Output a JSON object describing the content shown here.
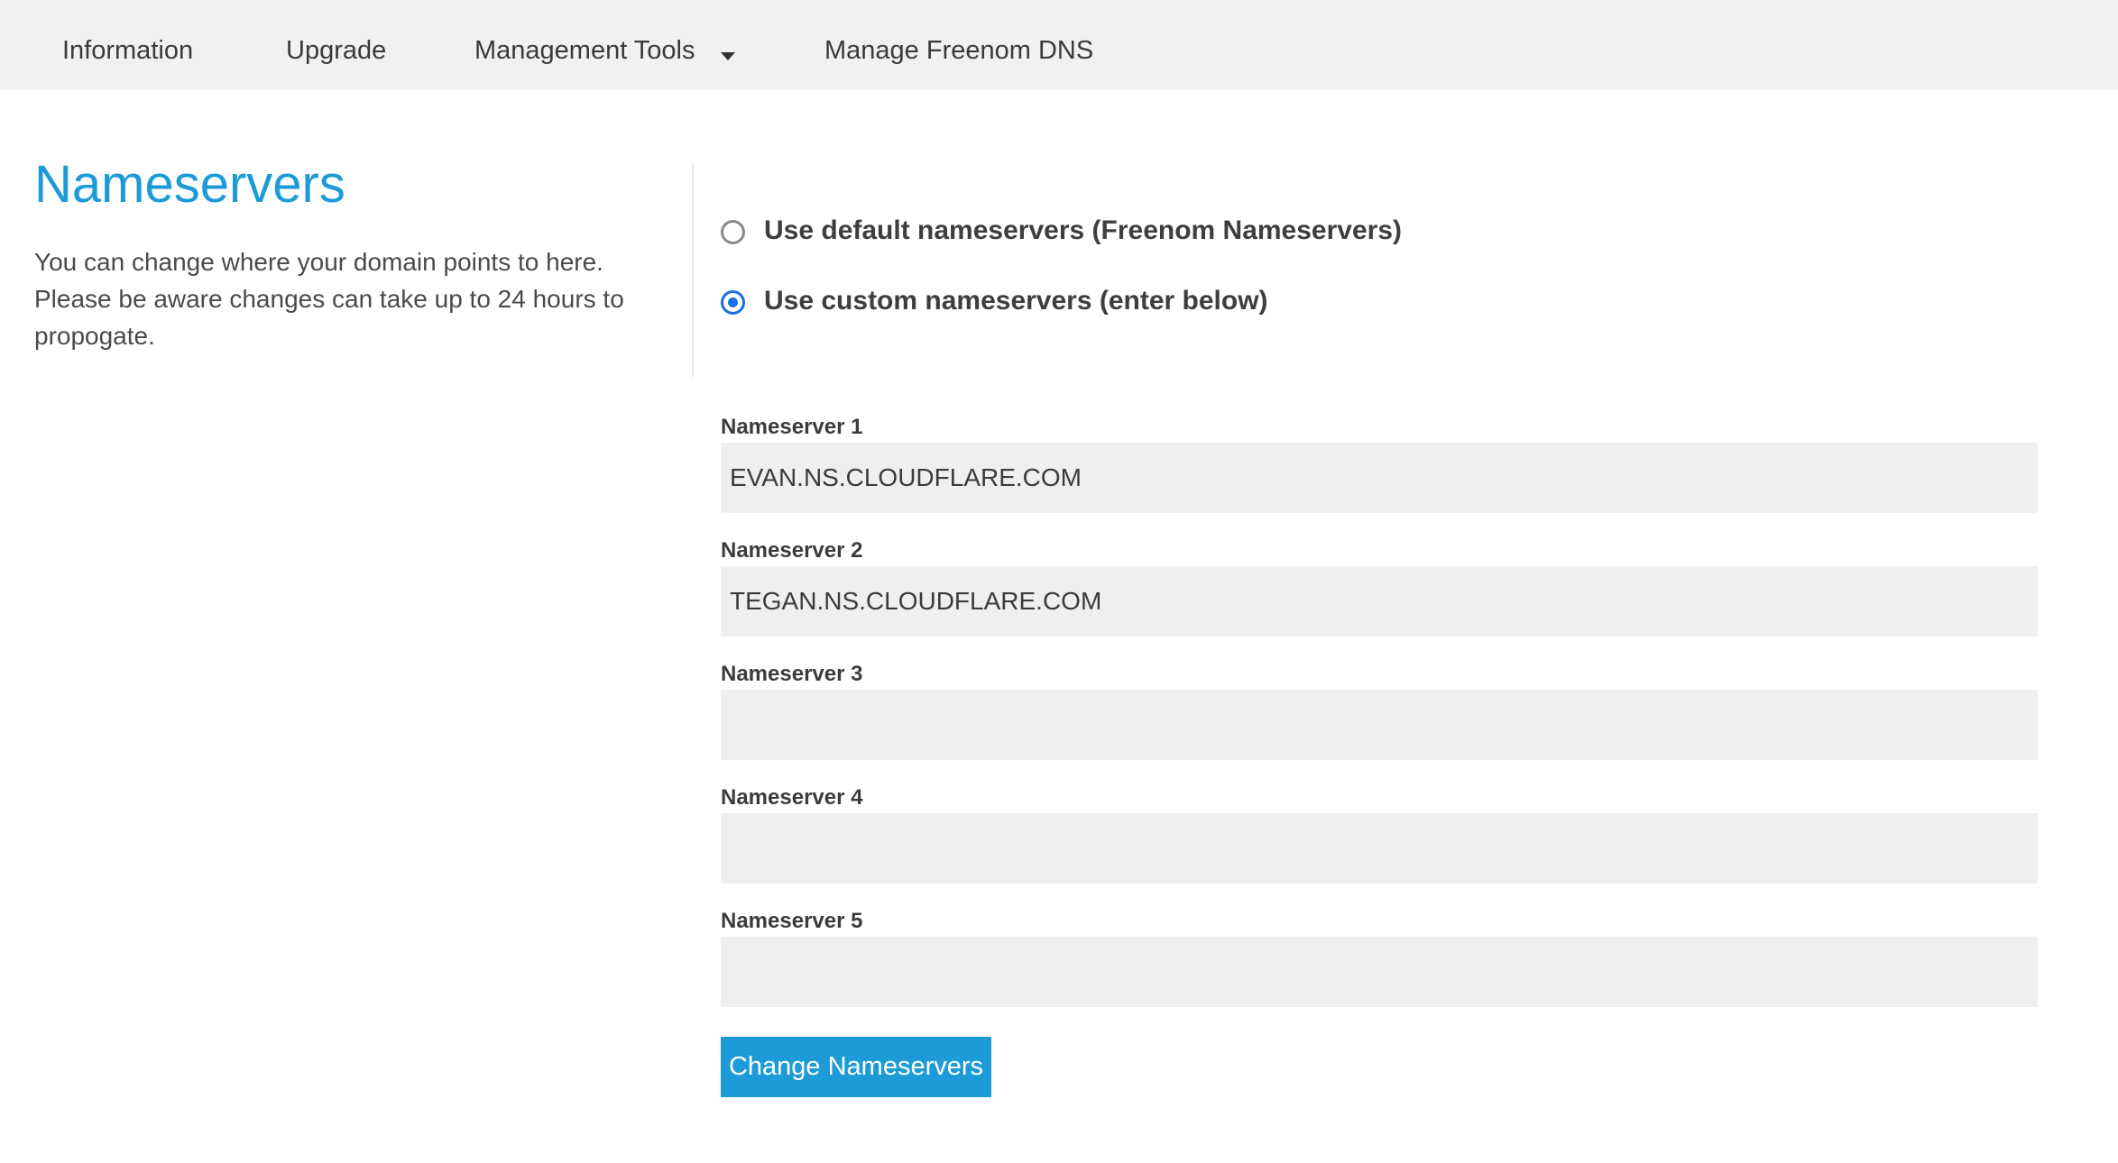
{
  "nav": {
    "items": [
      {
        "label": "Information"
      },
      {
        "label": "Upgrade"
      },
      {
        "label": "Management Tools"
      },
      {
        "label": "Manage Freenom DNS"
      }
    ]
  },
  "section": {
    "title": "Nameservers",
    "description": "You can change where your domain points to here. Please be aware changes can take up to 24 hours to propogate."
  },
  "options": {
    "default_label": "Use default nameservers (Freenom Nameservers)",
    "custom_label": "Use custom nameservers (enter below)",
    "selected": "custom"
  },
  "nameservers": [
    {
      "label": "Nameserver 1",
      "value": "EVAN.NS.CLOUDFLARE.COM"
    },
    {
      "label": "Nameserver 2",
      "value": "TEGAN.NS.CLOUDFLARE.COM"
    },
    {
      "label": "Nameserver 3",
      "value": ""
    },
    {
      "label": "Nameserver 4",
      "value": ""
    },
    {
      "label": "Nameserver 5",
      "value": ""
    }
  ],
  "submit_label": "Change Nameservers",
  "colors": {
    "accent": "#1d9bd8",
    "radio_selected": "#1a6ee8",
    "nav_background": "#f1f1f1",
    "input_background": "#efefef"
  }
}
